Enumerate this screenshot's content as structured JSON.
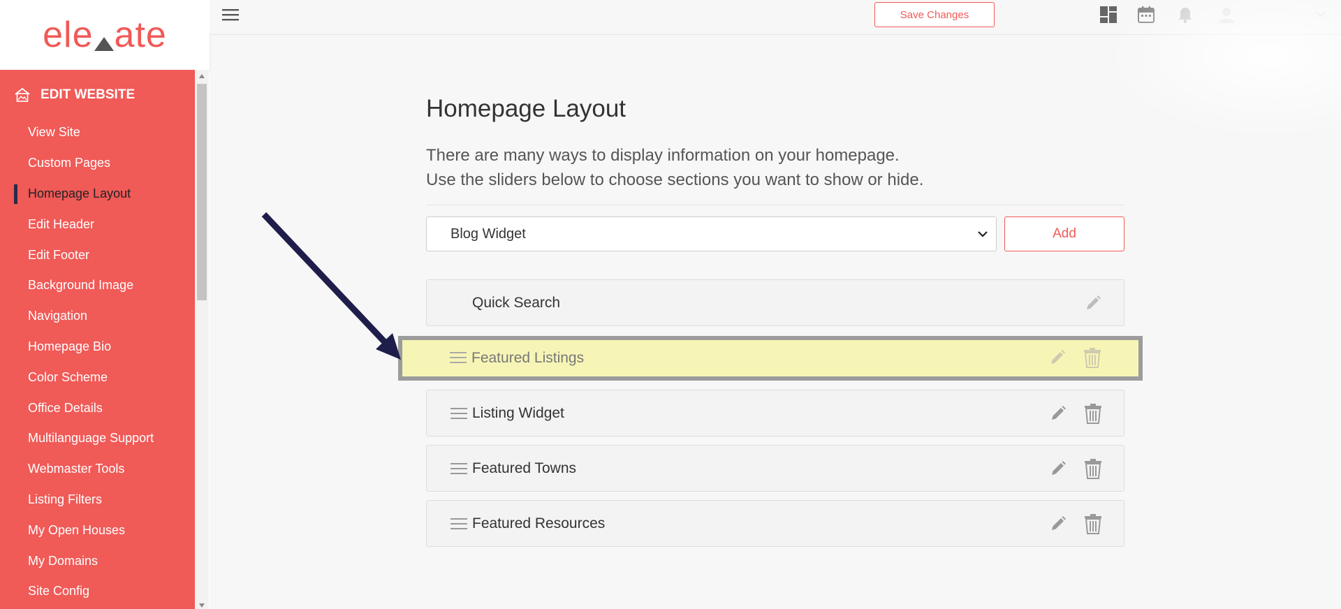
{
  "brand": {
    "logo_left": "ele",
    "logo_right": "ate"
  },
  "topbar": {
    "save_label": "Save Changes"
  },
  "sidebar": {
    "header": "EDIT WEBSITE",
    "items": [
      {
        "label": "View Site"
      },
      {
        "label": "Custom Pages"
      },
      {
        "label": "Homepage Layout",
        "active": true
      },
      {
        "label": "Edit Header"
      },
      {
        "label": "Edit Footer"
      },
      {
        "label": "Background Image"
      },
      {
        "label": "Navigation"
      },
      {
        "label": "Homepage Bio"
      },
      {
        "label": "Color Scheme"
      },
      {
        "label": "Office Details"
      },
      {
        "label": "Multilanguage Support"
      },
      {
        "label": "Webmaster Tools"
      },
      {
        "label": "Listing Filters"
      },
      {
        "label": "My Open Houses"
      },
      {
        "label": "My Domains"
      },
      {
        "label": "Site Config"
      }
    ]
  },
  "main": {
    "title": "Homepage Layout",
    "desc_line1": "There are many ways to display information on your homepage.",
    "desc_line2": "Use the sliders below to choose sections you want to show or hide.",
    "select_value": "Blog Widget",
    "add_label": "Add",
    "sections": [
      {
        "label": "Quick Search"
      },
      {
        "label": "Featured Listings"
      },
      {
        "label": "Listing Widget"
      },
      {
        "label": "Featured Towns"
      },
      {
        "label": "Featured Resources"
      }
    ]
  },
  "colors": {
    "accent": "#f05a57",
    "arrow": "#1f1d4a",
    "highlight": "#f7f5b6"
  }
}
